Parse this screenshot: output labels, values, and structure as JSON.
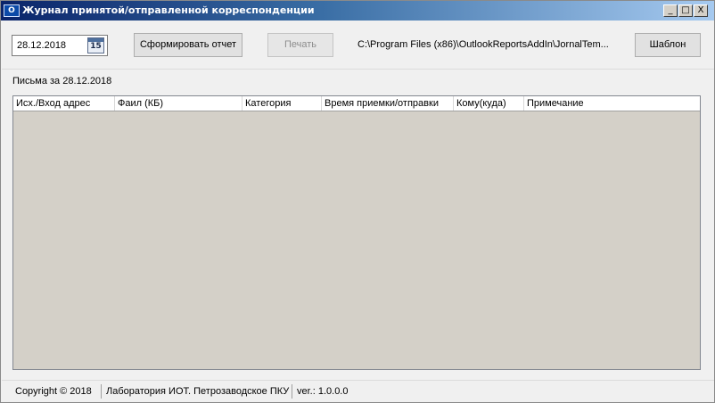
{
  "window": {
    "icon_text": "O",
    "title": "Журнал принятой/отправленной корреспонденции",
    "controls": {
      "minimize": "_",
      "maximize": "□",
      "close": "X"
    }
  },
  "toolbar": {
    "date_value": "28.12.2018",
    "calendar_day": "15",
    "generate_label": "Сформировать отчет",
    "print_label": "Печать",
    "template_path": "C:\\Program Files (x86)\\OutlookReportsAddIn\\JornalTem...",
    "template_label": "Шаблон"
  },
  "main": {
    "letters_label": "Письма за 28.12.2018",
    "columns": [
      "Исх./Вход адрес",
      "Фаил (КБ)",
      "Категория",
      "Время приемки/отправки",
      "Кому(куда)",
      "Примечание"
    ]
  },
  "status": {
    "copyright": "Copyright ©  2018",
    "company": "Лаборатория ИОТ. Петрозаводское ПКУ",
    "version": "ver.: 1.0.0.0"
  }
}
